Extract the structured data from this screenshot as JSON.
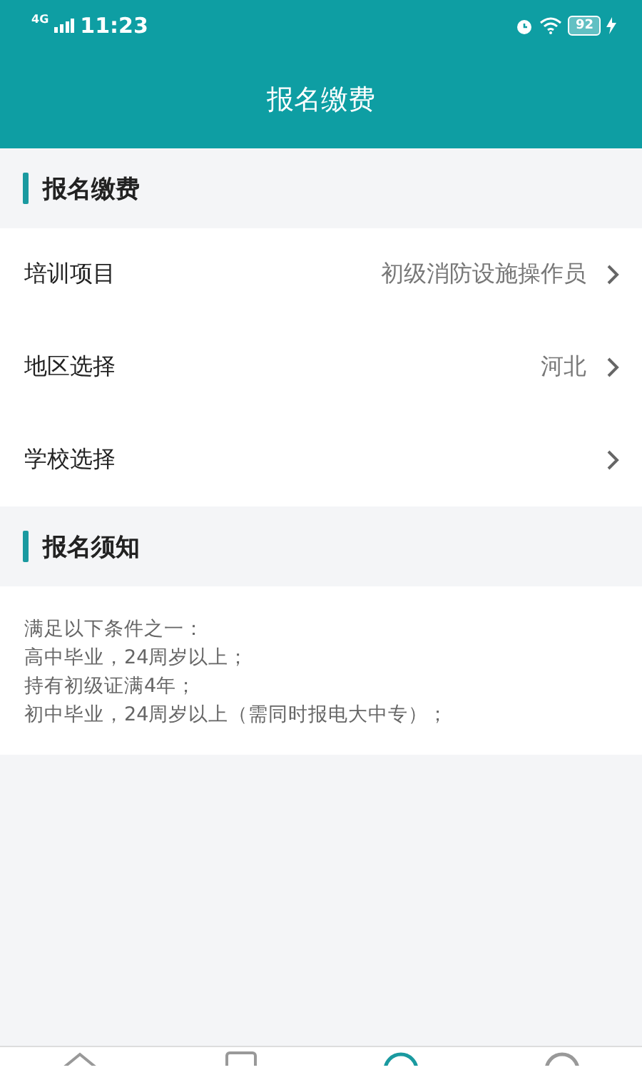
{
  "status_bar": {
    "network": "4G",
    "time": "11:23",
    "battery": "92"
  },
  "header": {
    "title": "报名缴费"
  },
  "sections": [
    {
      "title": "报名缴费",
      "kind": "rows",
      "rows": [
        {
          "label": "培训项目",
          "value": "初级消防设施操作员"
        },
        {
          "label": "地区选择",
          "value": "河北"
        },
        {
          "label": "学校选择"
        }
      ]
    },
    {
      "title": "报名须知",
      "kind": "notice",
      "lines": [
        "满足以下条件之一：",
        "高中毕业，24周岁以上；",
        "持有初级证满4年；",
        "初中毕业，24周岁以上（需同时报电大中专）；"
      ]
    }
  ],
  "tab_bar": {
    "tabs": [
      {
        "kind": "home",
        "selected": false
      },
      {
        "kind": "document",
        "selected": false
      },
      {
        "kind": "circle",
        "selected": true
      },
      {
        "kind": "circle",
        "selected": false
      }
    ]
  }
}
